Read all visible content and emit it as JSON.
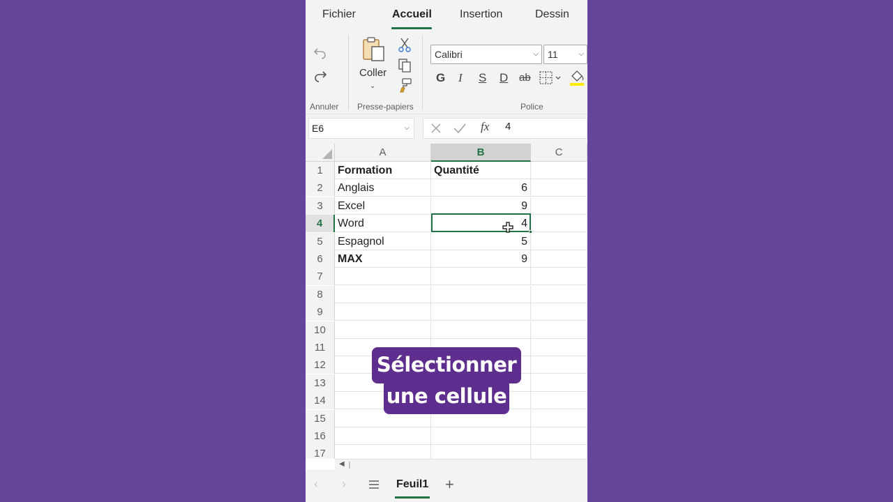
{
  "ribbon_tabs": [
    {
      "label": "Fichier"
    },
    {
      "label": "Accueil",
      "active": true
    },
    {
      "label": "Insertion"
    },
    {
      "label": "Dessin"
    }
  ],
  "ribbon": {
    "groups": {
      "undo": "Annuler",
      "clipboard": "Presse-papiers",
      "font": "Police"
    },
    "paste_label": "Coller",
    "font_name": "Calibri",
    "font_size": "11",
    "format_buttons": [
      "G",
      "I",
      "S",
      "D",
      "ab"
    ]
  },
  "formula_bar": {
    "name_box": "E6",
    "fx": "fx",
    "value": "4"
  },
  "grid": {
    "columns": [
      "A",
      "B",
      "C"
    ],
    "selected_column": "B",
    "selected_row": 4,
    "row_numbers": [
      "1",
      "2",
      "3",
      "4",
      "5",
      "6",
      "7",
      "8",
      "9",
      "10",
      "11",
      "12",
      "13",
      "14",
      "15",
      "16",
      "17"
    ],
    "rows": [
      {
        "a": "Formation",
        "b": "Quantité"
      },
      {
        "a": "Anglais",
        "b": "6"
      },
      {
        "a": "Excel",
        "b": "9"
      },
      {
        "a": "Word",
        "b": "4"
      },
      {
        "a": "Espagnol",
        "b": "5"
      },
      {
        "a": "MAX",
        "b": "9"
      }
    ]
  },
  "sheet": {
    "tab_name": "Feuil1"
  },
  "caption": {
    "line1": "Sélectionner",
    "line2": "une cellule"
  },
  "colors": {
    "background": "#65449a",
    "accent": "#217346",
    "caption_bg": "#5d2e8e"
  }
}
